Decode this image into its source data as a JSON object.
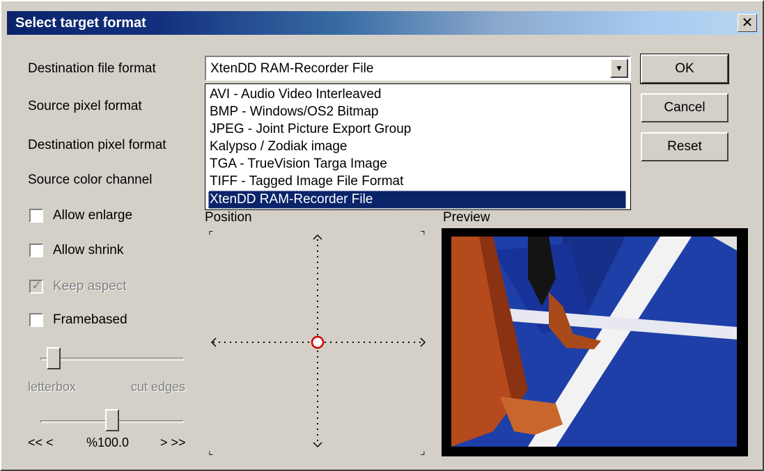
{
  "dialog": {
    "title": "Select target format",
    "close_glyph": "✕"
  },
  "labels": {
    "dest_file_format": "Destination file format",
    "source_pixel_format": "Source pixel format",
    "dest_pixel_format": "Destination pixel format",
    "source_color_channel": "Source color channel",
    "position": "Position",
    "preview": "Preview"
  },
  "combo": {
    "value": "XtenDD RAM-Recorder File",
    "arrow_icon": "chevron-down-icon"
  },
  "dropdown": {
    "options": [
      "AVI - Audio Video Interleaved",
      "BMP - Windows/OS2 Bitmap",
      "JPEG - Joint Picture Export Group",
      "Kalypso / Zodiak image",
      "TGA - TrueVision Targa Image",
      "TIFF - Tagged Image File Format",
      "XtenDD RAM-Recorder File"
    ],
    "selected_index": 6
  },
  "buttons": {
    "ok": "OK",
    "cancel": "Cancel",
    "reset": "Reset"
  },
  "checkboxes": {
    "allow_enlarge": {
      "label": "Allow enlarge",
      "checked": false
    },
    "allow_shrink": {
      "label": "Allow shrink",
      "checked": false
    },
    "keep_aspect": {
      "label": "Keep aspect",
      "checked": true,
      "disabled": true
    },
    "framebased": {
      "label": "Framebased",
      "checked": false
    }
  },
  "slider1": {
    "left_label": "letterbox",
    "right_label": "cut edges",
    "value_fraction": 0.05
  },
  "slider2": {
    "left_label": "<< <",
    "center_label": "%100.0",
    "right_label": "> >>",
    "value_fraction": 0.5
  },
  "colors": {
    "title_bar_start": "#0a246a",
    "selection": "#0a246a",
    "dialog_face": "#d4d0c8",
    "preview_track": "#1e3fa8",
    "position_marker": "#cc0000"
  }
}
